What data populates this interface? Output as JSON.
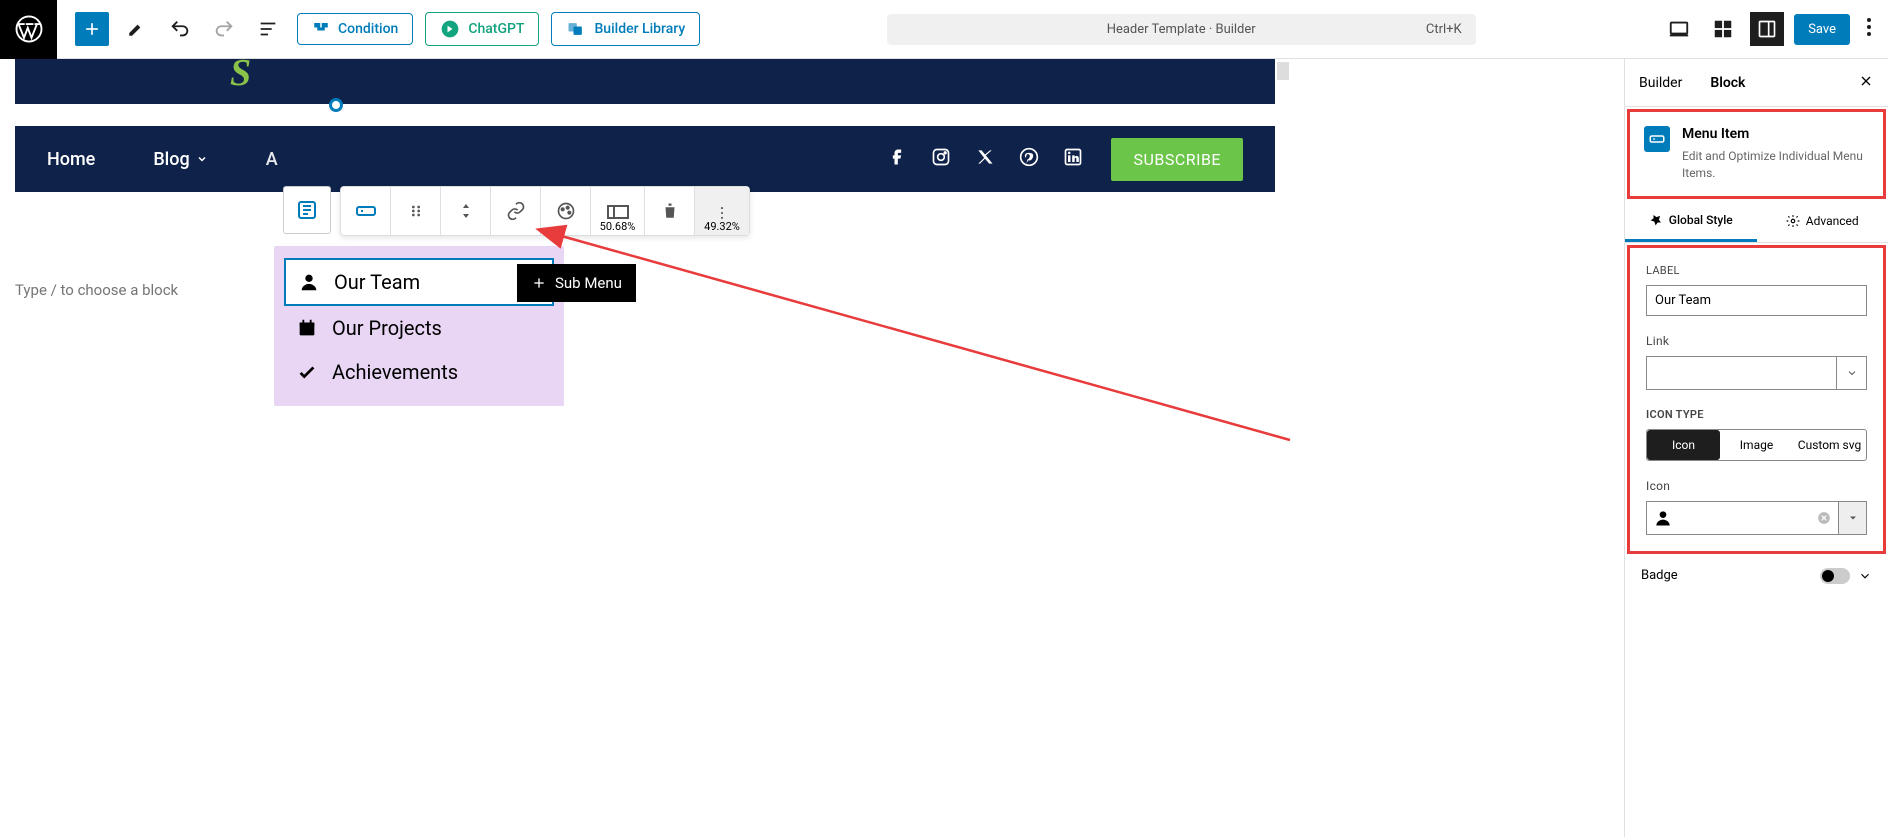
{
  "toolbar": {
    "condition": "Condition",
    "chatgpt": "ChatGPT",
    "library": "Builder Library",
    "title": "Header Template · Builder",
    "shortcut": "Ctrl+K",
    "save": "Save"
  },
  "nav": {
    "home": "Home",
    "blog": "Blog",
    "about_partial": "A",
    "subscribe": "SUBSCRIBE"
  },
  "block_toolbar": {
    "pct1": "50.68%",
    "pct2": "49.32%"
  },
  "submenu": {
    "items": [
      {
        "label": "Our Team",
        "icon": "person"
      },
      {
        "label": "Our Projects",
        "icon": "calendar"
      },
      {
        "label": "Achievements",
        "icon": "check"
      }
    ],
    "add_btn": "Sub Menu"
  },
  "placeholder": "Type / to choose a block",
  "sidebar": {
    "tabs": {
      "builder": "Builder",
      "block": "Block"
    },
    "block_info": {
      "title": "Menu Item",
      "desc": "Edit and Optimize Individual Menu Items."
    },
    "style_tabs": {
      "global": "Global Style",
      "advanced": "Advanced"
    },
    "panel": {
      "label_heading": "LABEL",
      "label_value": "Our Team",
      "link_heading": "Link",
      "icon_type_heading": "ICON TYPE",
      "icon_type": {
        "icon": "Icon",
        "image": "Image",
        "custom": "Custom svg"
      },
      "icon_heading": "Icon"
    },
    "badge": "Badge"
  }
}
